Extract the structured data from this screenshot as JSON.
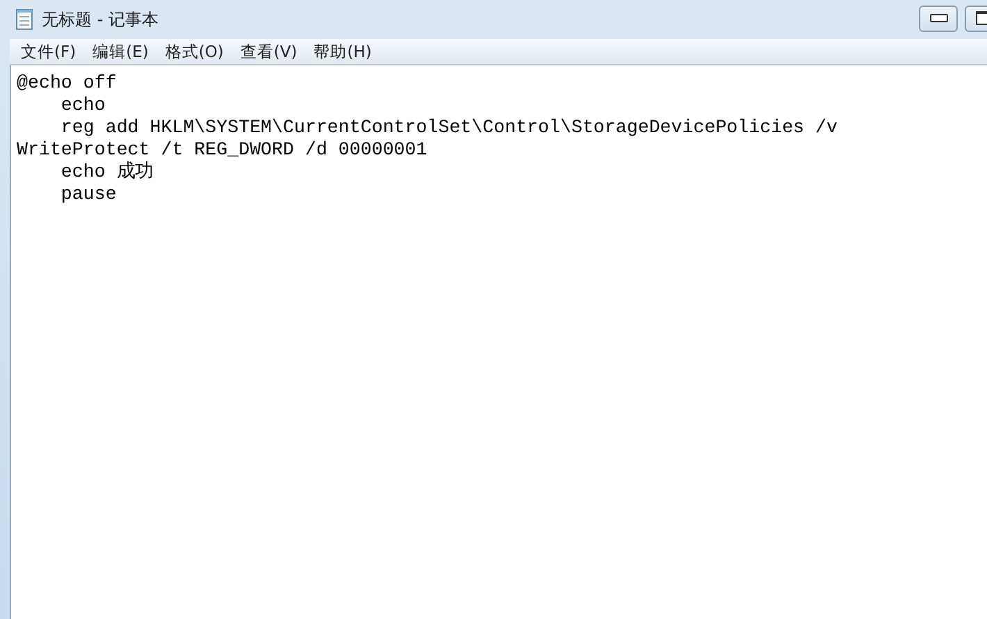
{
  "window": {
    "title": "无标题 - 记事本"
  },
  "menu": [
    "文件(F)",
    "编辑(E)",
    "格式(O)",
    "查看(V)",
    "帮助(H)"
  ],
  "lines": [
    "@echo off",
    "    echo",
    "    reg add HKLM\\SYSTEM\\CurrentControlSet\\Control\\StorageDevicePolicies /v",
    "WriteProtect /t REG_DWORD /d 00000001",
    "    echo 成功",
    "    pause"
  ]
}
